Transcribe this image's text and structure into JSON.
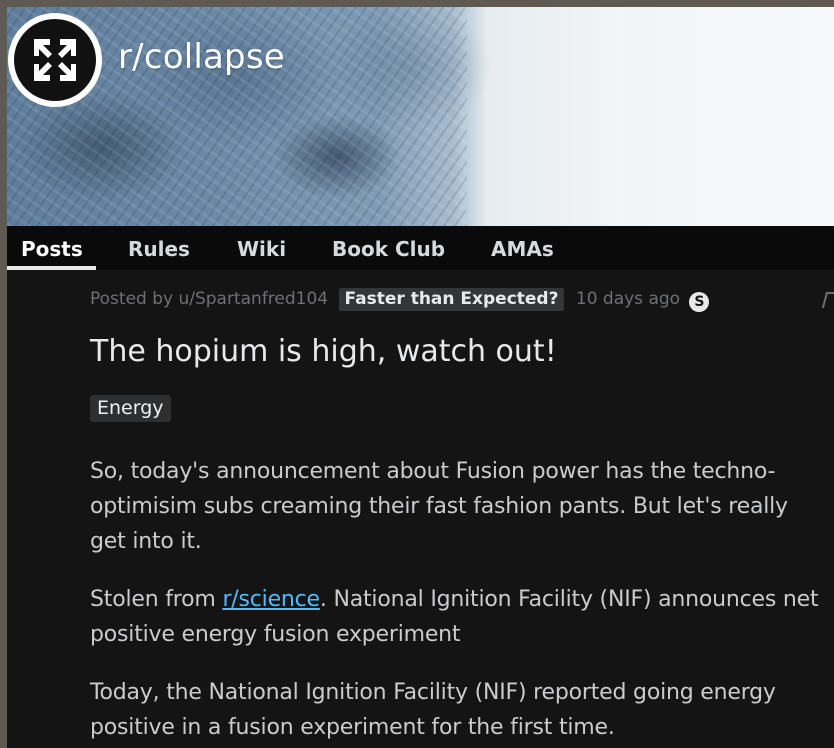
{
  "subreddit": {
    "name": "r/collapse",
    "logo_icon": "arrows-inward-icon"
  },
  "tabs": [
    {
      "label": "Posts",
      "active": true
    },
    {
      "label": "Rules",
      "active": false
    },
    {
      "label": "Wiki",
      "active": false
    },
    {
      "label": "Book Club",
      "active": false
    },
    {
      "label": "AMAs",
      "active": false
    }
  ],
  "post": {
    "posted_by": "Posted by u/Spartanfred104",
    "user_flair": "Faster than Expected?",
    "time": "10 days ago",
    "award": "S",
    "title": "The hopium is high, watch out!",
    "post_flair": "Energy",
    "body": {
      "p1": "So, today's announcement about Fusion power has the techno-optimisim subs creaming their fast fashion pants. But let's really get into it.",
      "p2_before": "Stolen from ",
      "p2_link": "r/science",
      "p2_after": ". National Ignition Facility (NIF) announces net positive energy fusion experiment",
      "p3": "Today, the National Ignition Facility (NIF) reported going energy positive in a fusion experiment for the first time."
    }
  },
  "colors": {
    "background": "#111112",
    "link": "#4fbcff",
    "flair_bg": "#343536"
  }
}
